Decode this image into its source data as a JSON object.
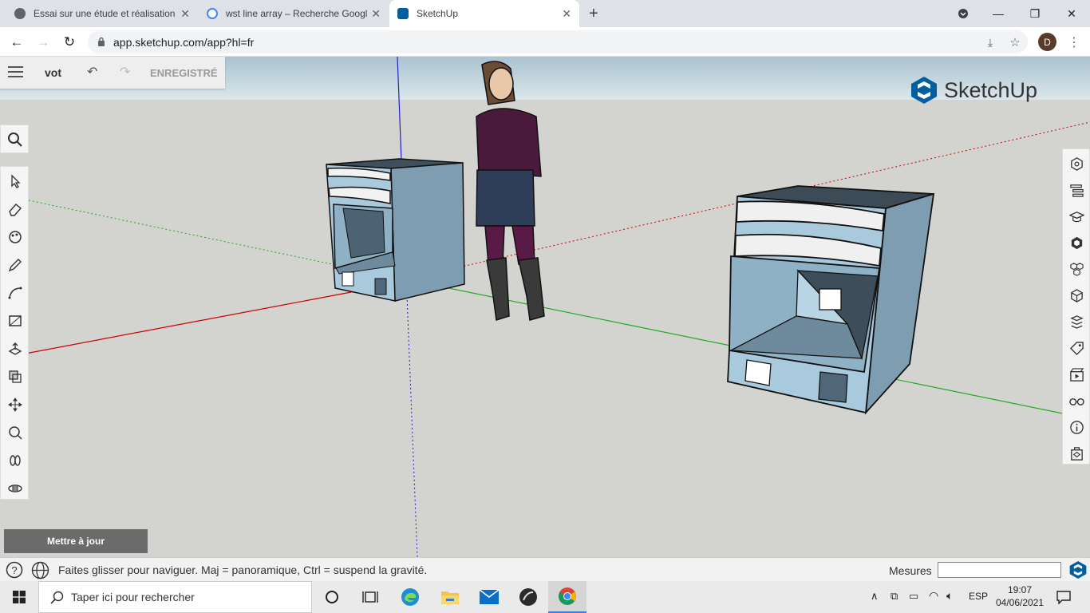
{
  "browser": {
    "tabs": [
      {
        "label": "Essai sur une étude et réalisation",
        "favicon_color": "#5f6368"
      },
      {
        "label": "wst line array – Recherche Googl",
        "favicon_color": "#4285f4"
      },
      {
        "label": "SketchUp",
        "favicon_color": "#005f9e"
      }
    ],
    "url": "app.sketchup.com/app?hl=fr",
    "profile_initial": "D"
  },
  "sketchup": {
    "file_name": "vot",
    "save_status": "ENREGISTRÉ",
    "brand": "SketchUp",
    "brand_color": "#005f9e",
    "update_button": "Mettre à jour",
    "status_hint": "Faites glisser pour naviguer. Maj = panoramique, Ctrl = suspend la gravité.",
    "measurements_label": "Mesures",
    "measurements_value": ""
  },
  "left_tools": [
    "search-icon",
    "select-icon",
    "eraser-icon",
    "paint-icon",
    "pencil-icon",
    "arc-icon",
    "push-pull-icon",
    "offset-icon",
    "move-icon",
    "rotate-icon",
    "tape-icon",
    "walk-icon",
    "orbit-icon"
  ],
  "right_tools": [
    "entity-info-icon",
    "outliner-icon",
    "instructor-icon",
    "components-icon",
    "materials-icon",
    "styles-icon",
    "layers-icon",
    "tags-icon",
    "scenes-icon",
    "display-icon",
    "info-icon",
    "export-icon"
  ],
  "taskbar": {
    "search_placeholder": "Taper ici pour rechercher",
    "language": "ESP",
    "time": "19:07",
    "date": "04/06/2021"
  }
}
